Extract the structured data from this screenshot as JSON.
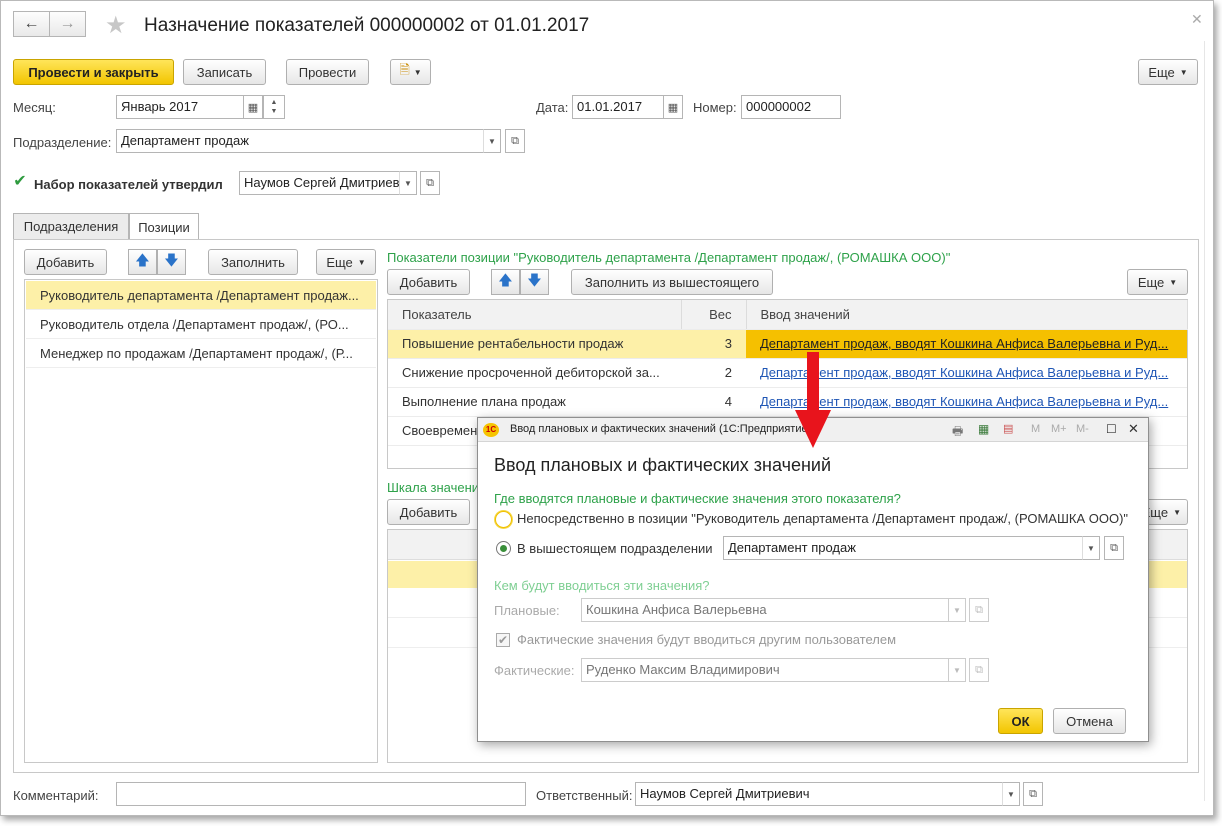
{
  "window": {
    "title": "Назначение показателей 000000002 от 01.01.2017",
    "back_icon": "arrow-left-icon",
    "forward_icon": "arrow-right-icon",
    "favorite_icon": "star-icon",
    "close_icon": "close-icon"
  },
  "toolbar": {
    "post_close": "Провести и закрыть",
    "write": "Записать",
    "post": "Провести",
    "more": "Еще"
  },
  "header": {
    "month_label": "Месяц:",
    "month_value": "Январь 2017",
    "date_label": "Дата:",
    "date_value": "01.01.2017",
    "number_label": "Номер:",
    "number_value": "000000002",
    "division_label": "Подразделение:",
    "division_value": "Департамент продаж",
    "approved_label": "Набор показателей утвердил",
    "approved_value": "Наумов Сергей Дмитриев"
  },
  "tabs": [
    "Подразделения",
    "Позиции"
  ],
  "left_panel": {
    "add": "Добавить",
    "fill": "Заполнить",
    "more": "Еще",
    "items": [
      "Руководитель департамента /Департамент продаж...",
      "Руководитель отдела /Департамент продаж/, (РО...",
      "Менеджер по продажам /Департамент продаж/, (Р..."
    ]
  },
  "right_panel": {
    "caption": "Показатели позиции \"Руководитель департамента /Департамент продаж/, (РОМАШКА ООО)\"",
    "add": "Добавить",
    "fill_from_parent": "Заполнить из вышестоящего",
    "more": "Еще",
    "columns": [
      "Показатель",
      "Вес",
      "Ввод значений"
    ],
    "rows": [
      {
        "name": "Повышение рентабельности продаж",
        "weight": "3",
        "input": "Департамент продаж, вводят Кошкина Анфиса Валерьевна и Руд..."
      },
      {
        "name": "Снижение просроченной дебиторской за...",
        "weight": "2",
        "input": "Департамент продаж, вводят Кошкина Анфиса Валерьевна и Руд..."
      },
      {
        "name": "Выполнение плана продаж",
        "weight": "4",
        "input": "Департамент продаж, вводят Кошкина Анфиса Валерьевна и Руд..."
      },
      {
        "name": "Своевремен",
        "weight": "",
        "input": ""
      }
    ],
    "scale_caption": "Шкала значени",
    "scale_add": "Добавить",
    "scale_more": "Еще"
  },
  "footer": {
    "comment_label": "Комментарий:",
    "comment_value": "",
    "responsible_label": "Ответственный:",
    "responsible_value": "Наумов Сергей Дмитриевич"
  },
  "dialog": {
    "window_title": "Ввод плановых и фактических значений  (1С:Предприятие)",
    "heading": "Ввод плановых и фактических значений",
    "question_where": "Где вводятся плановые и фактические значения этого показателя?",
    "option_direct": "Непосредственно в позиции \"Руководитель департамента /Департамент продаж/, (РОМАШКА ООО)\"",
    "option_parent": "В вышестоящем подразделении",
    "parent_value": "Департамент продаж",
    "question_who": "Кем будут вводиться эти значения?",
    "planned_label": "Плановые:",
    "planned_value": "Кошкина Анфиса Валерьевна",
    "actual_by_other": "Фактические значения будут вводиться другим пользователем",
    "actual_label": "Фактические:",
    "actual_value": "Руденко Максим Владимирович",
    "ok": "ОК",
    "cancel": "Отмена",
    "toolbar_icons": [
      "M",
      "M+",
      "M-"
    ]
  },
  "colors": {
    "accent_yellow": "#f2c500",
    "selection": "#fdf0a8",
    "green_text": "#2ea24a",
    "link": "#1f56b5",
    "arrow_red": "#e8141c"
  }
}
